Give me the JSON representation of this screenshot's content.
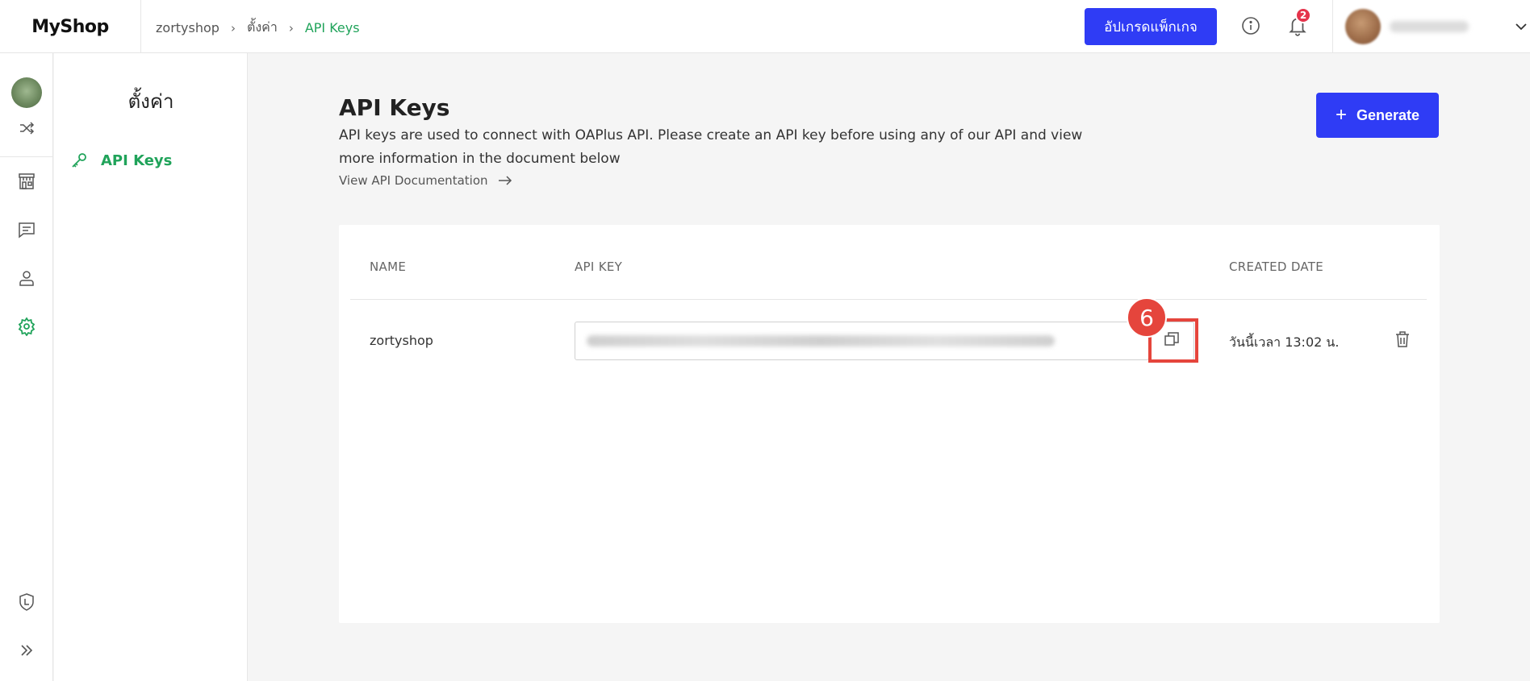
{
  "header": {
    "logo": "MyShop",
    "breadcrumb": [
      "zortyshop",
      "ตั้งค่า",
      "API Keys"
    ],
    "upgrade_label": "อัปเกรดแพ็กเกจ",
    "notification_count": "2",
    "icons": {
      "info": "info-icon",
      "bell": "bell-icon",
      "chevron": "chevron-down-icon"
    }
  },
  "rail": {
    "icons": [
      "shuffle-icon",
      "store-icon",
      "chat-icon",
      "user-icon",
      "settings-icon",
      "shield-icon",
      "double-chevron-right-icon"
    ],
    "active": "settings-icon"
  },
  "sidebar": {
    "title": "ตั้งค่า",
    "items": [
      {
        "label": "API Keys",
        "icon": "key-icon",
        "active": true
      }
    ]
  },
  "main": {
    "title": "API Keys",
    "description": "API keys are used to connect with OAPlus API. Please create an API key before using any of our API and view more information in the document below",
    "doc_link": "View API Documentation",
    "generate_label": "Generate",
    "table": {
      "headers": [
        "NAME",
        "API KEY",
        "CREATED DATE"
      ],
      "rows": [
        {
          "name": "zortyshop",
          "created": "วันนี้เวลา 13:02 น."
        }
      ]
    },
    "step_badge": "6"
  },
  "colors": {
    "accent": "#2f3cf5",
    "green": "#20a35a",
    "highlight": "#e5453c",
    "badge": "#e5334b"
  }
}
